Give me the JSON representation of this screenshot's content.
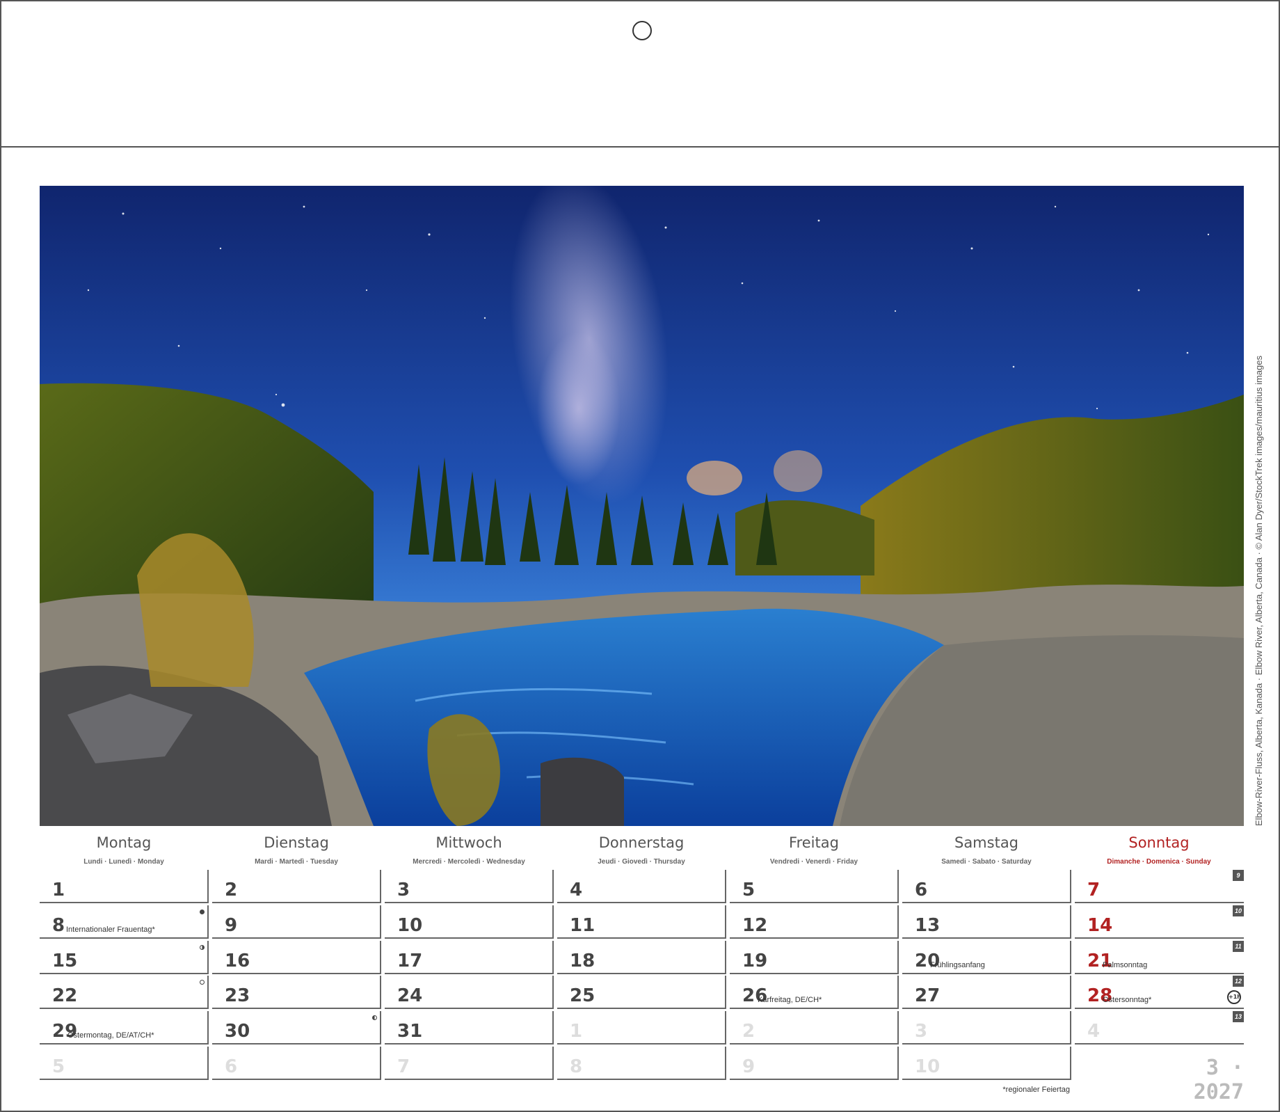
{
  "photo": {
    "credit": "Elbow-River-Fluss, Alberta, Kanada · Elbow River, Alberta, Canada · © Alan Dyer/StockTrek images/mauritius images"
  },
  "weekdays": [
    {
      "name": "Montag",
      "sub": "Lundi · Lunedì · Monday"
    },
    {
      "name": "Dienstag",
      "sub": "Mardi · Martedì · Tuesday"
    },
    {
      "name": "Mittwoch",
      "sub": "Mercredi · Mercoledì · Wednesday"
    },
    {
      "name": "Donnerstag",
      "sub": "Jeudi · Giovedì · Thursday"
    },
    {
      "name": "Freitag",
      "sub": "Vendredi · Venerdì · Friday"
    },
    {
      "name": "Samstag",
      "sub": "Samedi · Sabato · Saturday"
    },
    {
      "name": "Sonntag",
      "sub": "Dimanche · Domenica · Sunday"
    }
  ],
  "weeks": [
    {
      "kw": "9",
      "days": [
        {
          "n": "1"
        },
        {
          "n": "2"
        },
        {
          "n": "3"
        },
        {
          "n": "4"
        },
        {
          "n": "5"
        },
        {
          "n": "6"
        },
        {
          "n": "7"
        }
      ]
    },
    {
      "kw": "10",
      "days": [
        {
          "n": "8",
          "note": "Internationaler Frauentag*",
          "moon": "new"
        },
        {
          "n": "9"
        },
        {
          "n": "10"
        },
        {
          "n": "11"
        },
        {
          "n": "12"
        },
        {
          "n": "13"
        },
        {
          "n": "14"
        }
      ]
    },
    {
      "kw": "11",
      "days": [
        {
          "n": "15",
          "moon": "first"
        },
        {
          "n": "16"
        },
        {
          "n": "17"
        },
        {
          "n": "18"
        },
        {
          "n": "19"
        },
        {
          "n": "20",
          "note": "Frühlingsanfang"
        },
        {
          "n": "21",
          "note": "Palmsonntag"
        }
      ]
    },
    {
      "kw": "12",
      "days": [
        {
          "n": "22",
          "moon": "full"
        },
        {
          "n": "23"
        },
        {
          "n": "24"
        },
        {
          "n": "25"
        },
        {
          "n": "26",
          "note": "Karfreitag, DE/CH*"
        },
        {
          "n": "27"
        },
        {
          "n": "28",
          "note": "Ostersonntag*",
          "dst": "+1h"
        }
      ]
    },
    {
      "kw": "13",
      "days": [
        {
          "n": "29",
          "note": "Ostermontag, DE/AT/CH*"
        },
        {
          "n": "30",
          "moon": "last"
        },
        {
          "n": "31"
        },
        {
          "n": "1",
          "other": true
        },
        {
          "n": "2",
          "other": true
        },
        {
          "n": "3",
          "other": true
        },
        {
          "n": "4",
          "other": true
        }
      ]
    },
    {
      "kw": "",
      "days": [
        {
          "n": "5",
          "other": true
        },
        {
          "n": "6",
          "other": true
        },
        {
          "n": "7",
          "other": true
        },
        {
          "n": "8",
          "other": true
        },
        {
          "n": "9",
          "other": true
        },
        {
          "n": "10",
          "other": true
        }
      ]
    }
  ],
  "month_year": "3 · 2027",
  "footnote": "*regionaler Feiertag"
}
